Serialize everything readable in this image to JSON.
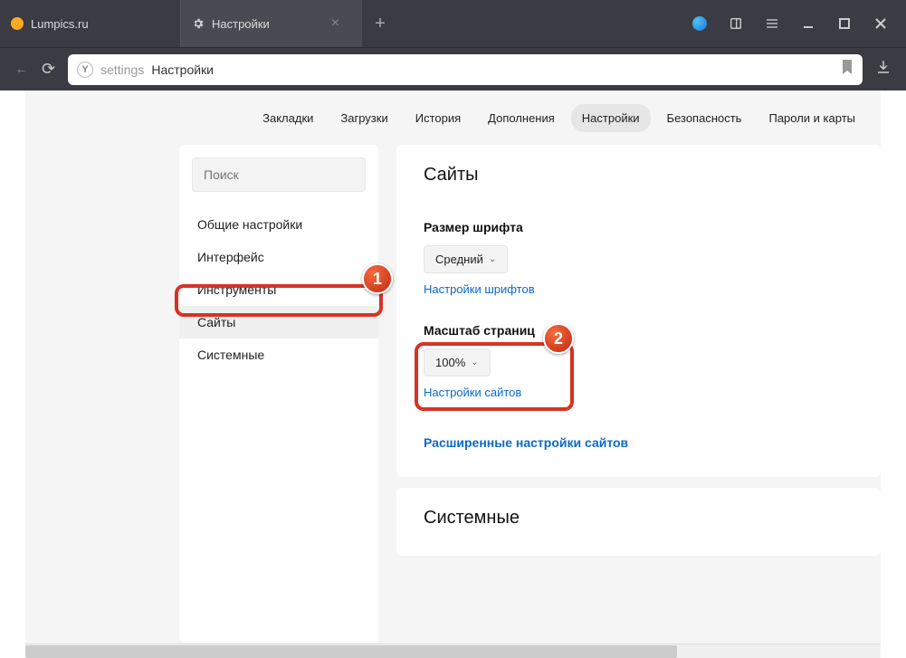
{
  "tabs": {
    "inactive": {
      "title": "Lumpics.ru"
    },
    "active": {
      "title": "Настройки"
    }
  },
  "address": {
    "category": "settings",
    "title": "Настройки"
  },
  "topnav": {
    "bookmarks": "Закладки",
    "downloads": "Загрузки",
    "history": "История",
    "addons": "Дополнения",
    "settings": "Настройки",
    "security": "Безопасность",
    "passwords": "Пароли и карты"
  },
  "sidebar": {
    "search_placeholder": "Поиск",
    "items": {
      "general": "Общие настройки",
      "interface": "Интерфейс",
      "tools": "Инструменты",
      "sites": "Сайты",
      "system": "Системные"
    }
  },
  "panel_sites": {
    "title": "Сайты",
    "font_size_label": "Размер шрифта",
    "font_size_value": "Средний",
    "font_settings_link": "Настройки шрифтов",
    "zoom_label": "Масштаб страниц",
    "zoom_value": "100%",
    "site_settings_link": "Настройки сайтов",
    "advanced_link": "Расширенные настройки сайтов"
  },
  "panel_system": {
    "title": "Системные"
  },
  "badges": {
    "one": "1",
    "two": "2"
  }
}
